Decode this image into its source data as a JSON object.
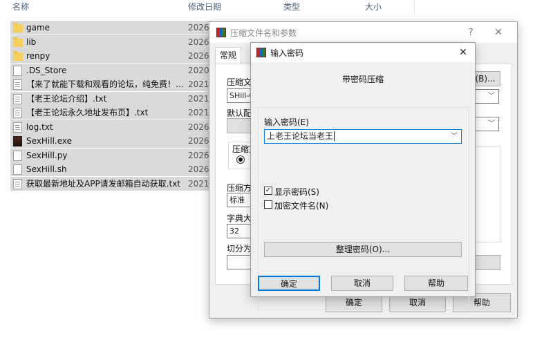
{
  "explorer": {
    "columns": {
      "name": "名称",
      "modified": "修改日期",
      "type": "类型",
      "size": "大小"
    },
    "files": [
      {
        "name": "game",
        "date": "2026/",
        "icon": "folder-icon"
      },
      {
        "name": "lib",
        "date": "2026/",
        "icon": "folder-icon"
      },
      {
        "name": "renpy",
        "date": "2026/",
        "icon": "folder-icon"
      },
      {
        "name": ".DS_Store",
        "date": "2020/",
        "icon": "file-icon"
      },
      {
        "name": "【来了就能下载和观看的论坛，纯免费！...",
        "date": "2021/",
        "icon": "text-file-icon"
      },
      {
        "name": "【老王论坛介绍】.txt",
        "date": "2021/",
        "icon": "text-file-icon"
      },
      {
        "name": "【老王论坛永久地址发布页】.txt",
        "date": "2021/",
        "icon": "text-file-icon"
      },
      {
        "name": "log.txt",
        "date": "2026/",
        "icon": "text-file-icon"
      },
      {
        "name": "SexHill.exe",
        "date": "2026/",
        "icon": "exe-icon"
      },
      {
        "name": "SexHill.py",
        "date": "2026/",
        "icon": "file-icon"
      },
      {
        "name": "SexHill.sh",
        "date": "2026/",
        "icon": "file-icon"
      },
      {
        "name": "获取最新地址及APP请发邮箱自动获取.txt",
        "date": "2021/",
        "icon": "text-file-icon"
      }
    ]
  },
  "archive_dialog": {
    "title": "压缩文件名和参数",
    "help_glyph": "?",
    "close_glyph": "✕",
    "tab_general": "常规",
    "archive_name_label": "压缩文",
    "archive_name_value": "SHill-0.",
    "browse_label": "(B)...",
    "profile_label": "默认配",
    "format_label": "压缩文",
    "method_label": "压缩方",
    "method_value": "标准",
    "dict_label": "字典大",
    "dict_value": "32",
    "split_label": "切分为",
    "ok": "确定",
    "cancel": "取消",
    "help": "帮助"
  },
  "password_dialog": {
    "title": "输入密码",
    "close_glyph": "✕",
    "heading": "带密码压缩",
    "input_label": "输入密码(E)",
    "password_value": "上老王论坛当老王",
    "show_password_label": "显示密码(S)",
    "show_password_checked": "✓",
    "encrypt_names_label": "加密文件名(N)",
    "organize_button": "整理密码(O)...",
    "ok": "确定",
    "cancel": "取消",
    "help": "帮助"
  }
}
